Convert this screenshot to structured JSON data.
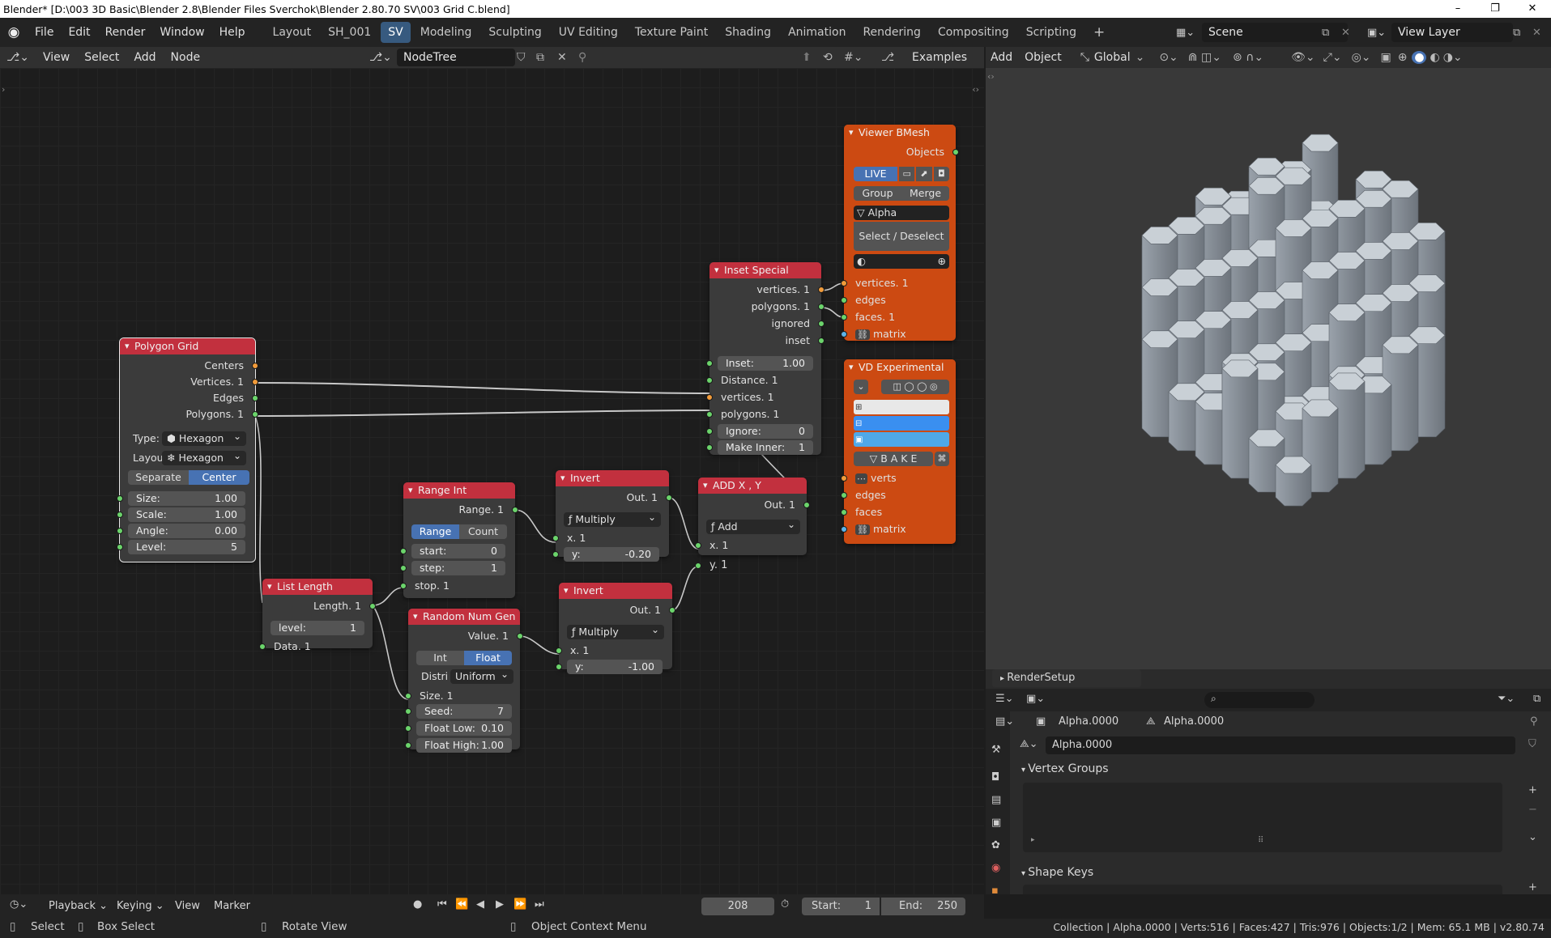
{
  "window": {
    "title": "Blender* [D:\\003 3D Basic\\Blender 2.8\\Blender Files Sverchok\\Blender 2.80.70 SV\\003 Grid C.blend]",
    "min": "–",
    "max": "❐",
    "close": "✕"
  },
  "menus": [
    "File",
    "Edit",
    "Render",
    "Window",
    "Help"
  ],
  "workspaces": [
    "Layout",
    "SH_001",
    "SV",
    "Modeling",
    "Sculpting",
    "UV Editing",
    "Texture Paint",
    "Shading",
    "Animation",
    "Rendering",
    "Compositing",
    "Scripting"
  ],
  "active_workspace": "SV",
  "add_ws": "+",
  "scene": "Scene",
  "view_layer": "View Layer",
  "node_header": {
    "menus": [
      "View",
      "Select",
      "Add",
      "Node"
    ],
    "tree_name": "NodeTree",
    "examples": "Examples"
  },
  "viewport_header": {
    "menus": [
      "Add",
      "Object"
    ],
    "orientation": "Global"
  },
  "nodes": {
    "polygon_grid": {
      "title": "Polygon Grid",
      "outputs": [
        "Centers",
        "Vertices. 1",
        "Edges",
        "Polygons. 1"
      ],
      "type_label": "Type:",
      "type_value": "Hexagon",
      "layout_label": "Layou",
      "layout_value": "Hexagon",
      "toggle": [
        "Separate",
        "Center"
      ],
      "fields": [
        {
          "label": "Size:",
          "value": "1.00"
        },
        {
          "label": "Scale:",
          "value": "1.00"
        },
        {
          "label": "Angle:",
          "value": "0.00"
        },
        {
          "label": "Level:",
          "value": "5"
        }
      ]
    },
    "list_length": {
      "title": "List Length",
      "output": "Length. 1",
      "level_label": "level:",
      "level_value": "1",
      "input": "Data. 1"
    },
    "range_int": {
      "title": "Range Int",
      "output": "Range. 1",
      "toggle": [
        "Range",
        "Count"
      ],
      "fields": [
        {
          "label": "start:",
          "value": "0"
        },
        {
          "label": "step:",
          "value": "1"
        }
      ],
      "input": "stop. 1"
    },
    "random_num": {
      "title": "Random Num Gen",
      "output": "Value. 1",
      "toggle": [
        "Int",
        "Float"
      ],
      "distr_label": "Distri",
      "distr_value": "Uniform",
      "input": "Size. 1",
      "fields": [
        {
          "label": "Seed:",
          "value": "7"
        },
        {
          "label": "Float Low:",
          "value": "0.10"
        },
        {
          "label": "Float High:",
          "value": "1.00"
        }
      ]
    },
    "invert1": {
      "title": "Invert",
      "output": "Out. 1",
      "op": "Multiply",
      "x": "x. 1",
      "y_label": "y:",
      "y_value": "-0.20"
    },
    "invert2": {
      "title": "Invert",
      "output": "Out. 1",
      "op": "Multiply",
      "x": "x. 1",
      "y_label": "y:",
      "y_value": "-1.00"
    },
    "add_xy": {
      "title": "ADD X , Y",
      "output": "Out. 1",
      "op": "Add",
      "x": "x. 1",
      "y": "y. 1"
    },
    "inset": {
      "title": "Inset Special",
      "outputs": [
        "vertices. 1",
        "polygons. 1",
        "ignored",
        "inset"
      ],
      "inset_label": "Inset:",
      "inset_value": "1.00",
      "inputs": [
        "Distance. 1",
        "vertices. 1",
        "polygons. 1"
      ],
      "ignore_label": "Ignore:",
      "ignore_value": "0",
      "make_label": "Make Inner:",
      "make_value": "1"
    },
    "viewer": {
      "title": "Viewer BMesh",
      "output": "Objects",
      "live": "LIVE",
      "group": "Group",
      "merge": "Merge",
      "name": "Alpha",
      "select": "Select / Deselect",
      "inputs": [
        "vertices. 1",
        "edges",
        "faces. 1",
        "matrix"
      ]
    },
    "vd": {
      "title": "VD Experimental",
      "bake": "B A K E",
      "inputs": [
        "verts",
        "edges",
        "faces",
        "matrix"
      ]
    }
  },
  "properties": {
    "render_setup": "RenderSetup",
    "object_name": "Alpha.0000",
    "mesh_name": "Alpha.0000",
    "data_name": "Alpha.0000",
    "vertex_groups": "Vertex Groups",
    "shape_keys": "Shape Keys"
  },
  "timeline": {
    "menus": [
      "Playback",
      "Keying",
      "View",
      "Marker"
    ],
    "frame": "208",
    "start_label": "Start:",
    "start": "1",
    "end_label": "End:",
    "end": "250"
  },
  "status": {
    "select": "Select",
    "box_select": "Box Select",
    "rotate": "Rotate View",
    "context": "Object Context Menu",
    "stats": "Collection | Alpha.0000 | Verts:516 | Faces:427 | Tris:976 | Objects:1/2 | Mem: 65.1 MB | v2.80.74"
  },
  "colors": {
    "node_header_red": "#c2303e",
    "viewer_orange": "#cc4a12",
    "socket_green": "#6bd46b",
    "socket_orange": "#f19b3a",
    "active_blue": "#4772b3"
  }
}
